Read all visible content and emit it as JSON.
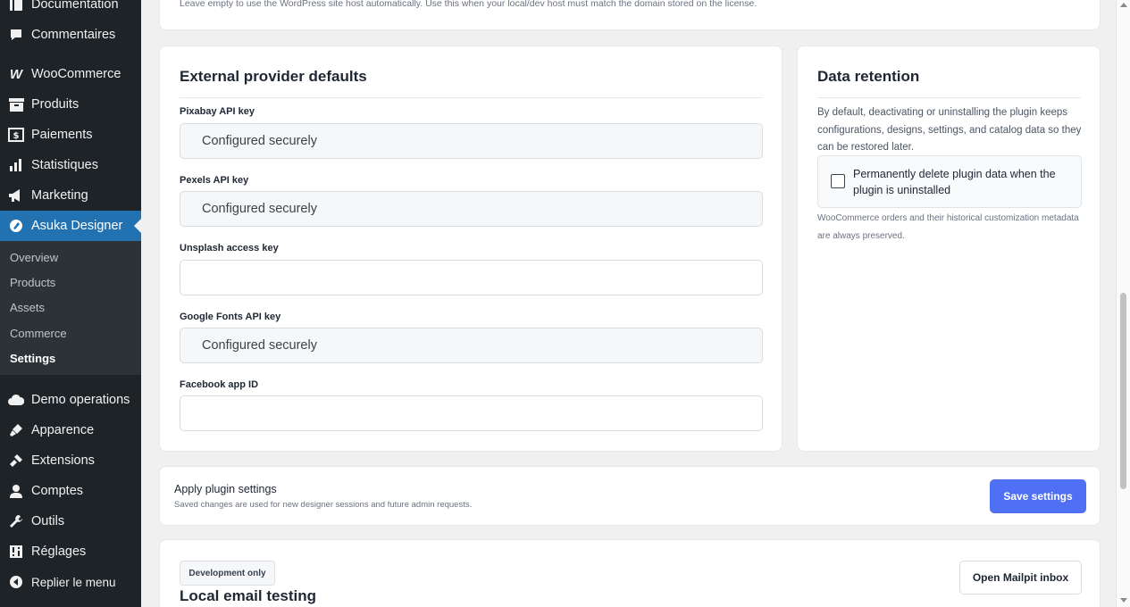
{
  "sidebar": {
    "items": [
      {
        "label": "Documentation",
        "icon": "documentation-icon"
      },
      {
        "label": "Commentaires",
        "icon": "comments-icon"
      },
      {
        "label": "WooCommerce",
        "icon": "woocommerce-icon"
      },
      {
        "label": "Produits",
        "icon": "products-icon"
      },
      {
        "label": "Paiements",
        "icon": "payments-icon"
      },
      {
        "label": "Statistiques",
        "icon": "stats-icon"
      },
      {
        "label": "Marketing",
        "icon": "marketing-icon"
      },
      {
        "label": "Asuka Designer",
        "icon": "asuka-designer-icon"
      },
      {
        "label": "Demo operations",
        "icon": "cloud-icon"
      },
      {
        "label": "Apparence",
        "icon": "appearance-icon"
      },
      {
        "label": "Extensions",
        "icon": "plugins-icon"
      },
      {
        "label": "Comptes",
        "icon": "users-icon"
      },
      {
        "label": "Outils",
        "icon": "tools-icon"
      },
      {
        "label": "Réglages",
        "icon": "settings-icon"
      },
      {
        "label": "Replier le menu",
        "icon": "collapse-icon"
      }
    ],
    "submenu": [
      "Overview",
      "Products",
      "Assets",
      "Commerce",
      "Settings"
    ],
    "accent": "#2271b1"
  },
  "top_hint": "Leave empty to use the WordPress site host automatically. Use this when your local/dev host must match the domain stored on the license.",
  "providers": {
    "title": "External provider defaults",
    "fields": [
      {
        "label": "Pixabay API key",
        "value": "Configured securely"
      },
      {
        "label": "Pexels API key",
        "value": "Configured securely"
      },
      {
        "label": "Unsplash access key",
        "value": ""
      },
      {
        "label": "Google Fonts API key",
        "value": "Configured securely"
      },
      {
        "label": "Facebook app ID",
        "value": ""
      }
    ]
  },
  "retention": {
    "title": "Data retention",
    "description": "By default, deactivating or uninstalling the plugin keeps configurations, designs, settings, and catalog data so they can be restored later.",
    "checkbox_label": "Permanently delete plugin data when the plugin is uninstalled",
    "checked": false,
    "note": "WooCommerce orders and their historical customization metadata are always preserved."
  },
  "apply": {
    "title": "Apply plugin settings",
    "subtitle": "Saved changes are used for new designer sessions and future admin requests.",
    "save_label": "Save settings",
    "accent": "#4f6ff5"
  },
  "email": {
    "badge": "Development only",
    "title": "Local email testing",
    "button": "Open Mailpit inbox"
  }
}
